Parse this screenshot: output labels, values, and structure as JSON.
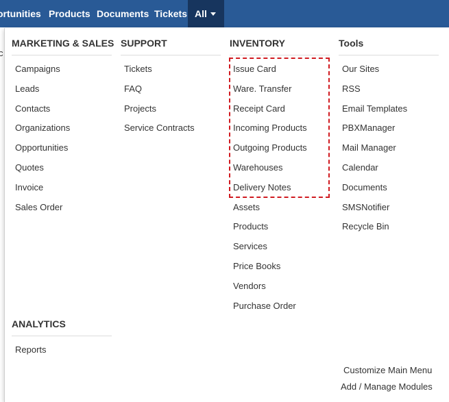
{
  "nav": {
    "items": [
      "ortunities",
      "Products",
      "Documents",
      "Tickets"
    ],
    "all_label": "All"
  },
  "page_fragment": "c",
  "menu": {
    "marketing": {
      "title": "MARKETING & SALES",
      "items": [
        "Campaigns",
        "Leads",
        "Contacts",
        "Organizations",
        "Opportunities",
        "Quotes",
        "Invoice",
        "Sales Order"
      ]
    },
    "support": {
      "title": "SUPPORT",
      "items": [
        "Tickets",
        "FAQ",
        "Projects",
        "Service Contracts"
      ]
    },
    "inventory": {
      "title": "INVENTORY",
      "items": [
        "Issue Card",
        "Ware. Transfer",
        "Receipt Card",
        "Incoming Products",
        "Outgoing Products",
        "Warehouses",
        "Delivery Notes",
        "Assets",
        "Products",
        "Services",
        "Price Books",
        "Vendors",
        "Purchase Order"
      ]
    },
    "tools": {
      "title": "Tools",
      "items": [
        "Our Sites",
        "RSS",
        "Email Templates",
        "PBXManager",
        "Mail Manager",
        "Calendar",
        "Documents",
        "SMSNotifier",
        "Recycle Bin"
      ]
    },
    "analytics": {
      "title": "ANALYTICS",
      "items": [
        "Reports"
      ]
    }
  },
  "footer": {
    "customize": "Customize Main Menu",
    "manage": "Add / Manage Modules"
  },
  "colors": {
    "topbar": "#295a96",
    "active_tab": "#17355e",
    "highlight": "#d0191f"
  }
}
